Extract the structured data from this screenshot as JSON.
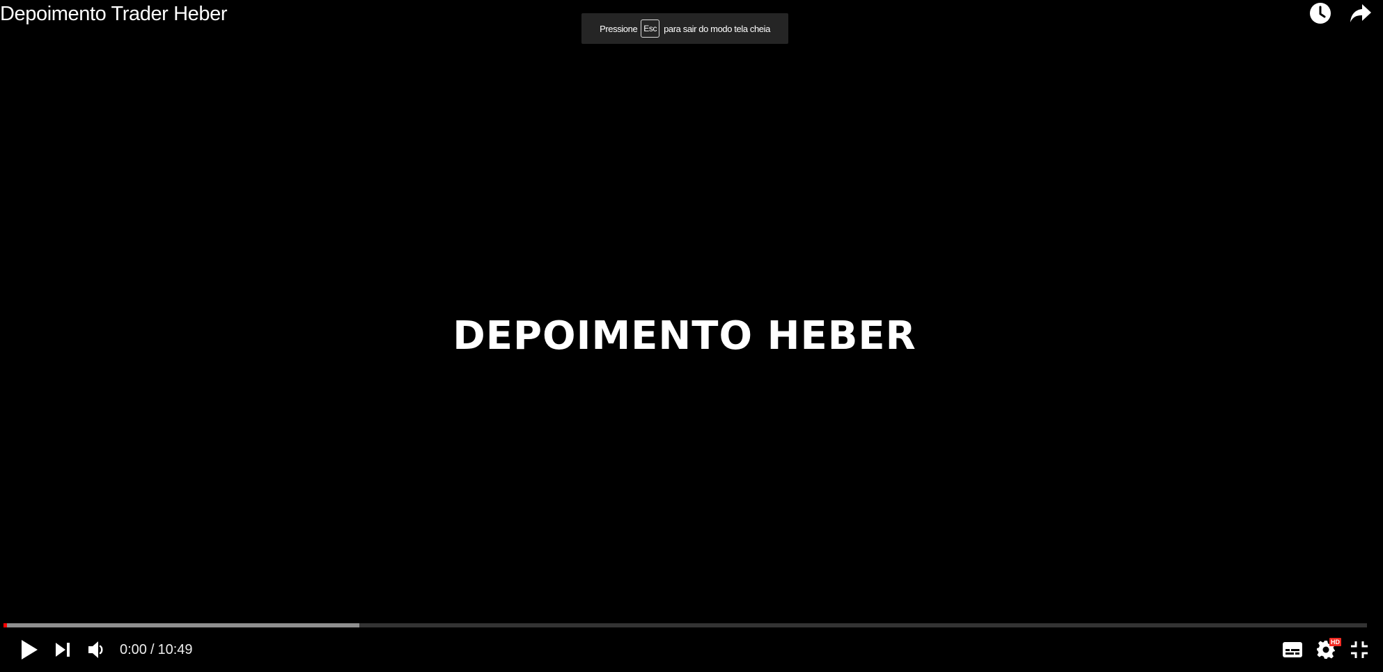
{
  "video": {
    "title": "Depoimento Trader Heber",
    "frame_text": "DEPOIMENTO HEBER"
  },
  "fullscreen_toast": {
    "prefix": "Pressione",
    "key": "Esc",
    "suffix": "para sair do modo tela cheia"
  },
  "top_actions": {
    "watch_later_icon": "clock-icon",
    "share_icon": "share-arrow-icon"
  },
  "progress": {
    "played_fraction": 0.0,
    "buffered_fraction": 0.261
  },
  "controls": {
    "current_time": "0:00",
    "separator": "/",
    "duration": "10:49",
    "quality_badge": "HD"
  },
  "colors": {
    "accent": "#ff0000",
    "hd_badge": "#f12b24",
    "background": "#000000"
  }
}
